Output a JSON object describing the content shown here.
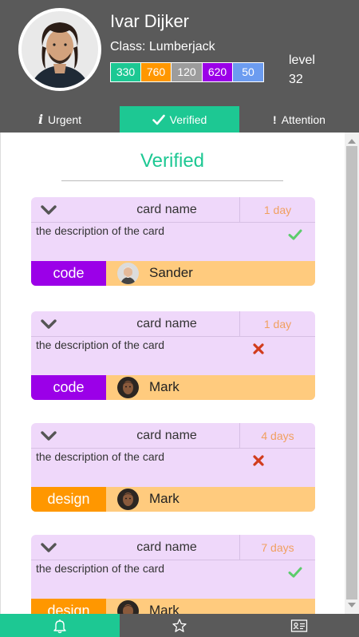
{
  "user": {
    "name": "Ivar Dijker",
    "class_label": "Class: Lumberjack",
    "stats": [
      {
        "value": "330",
        "color": "#1dc893"
      },
      {
        "value": "760",
        "color": "#ff9700"
      },
      {
        "value": "120",
        "color": "#9c9c9c"
      },
      {
        "value": "620",
        "color": "#9b00e8"
      },
      {
        "value": "50",
        "color": "#6c9cf0"
      }
    ],
    "level_label": "level",
    "level_value": "32"
  },
  "tabs": [
    {
      "label": "Urgent",
      "icon": "info-icon",
      "active": false
    },
    {
      "label": "Verified",
      "icon": "check-icon",
      "active": true
    },
    {
      "label": "Attention",
      "icon": "exclamation-icon",
      "active": false
    }
  ],
  "section": {
    "title": "Verified"
  },
  "cards": [
    {
      "name": "card name",
      "age": "1 day",
      "description": "the description of the card",
      "status": "check-icon",
      "tag": "code",
      "assignee": "Sander"
    },
    {
      "name": "card name",
      "age": "1 day",
      "description": "the description of the card",
      "status": "cross-icon",
      "tag": "code",
      "assignee": "Mark"
    },
    {
      "name": "card name",
      "age": "4 days",
      "description": "the description of the card",
      "status": "cross-icon",
      "tag": "design",
      "assignee": "Mark"
    },
    {
      "name": "card name",
      "age": "7 days",
      "description": "the description of the card",
      "status": "check-icon",
      "tag": "design",
      "assignee": "Mark"
    }
  ],
  "bottom_nav": [
    {
      "icon": "bell-icon",
      "active": true
    },
    {
      "icon": "star-icon",
      "active": false
    },
    {
      "icon": "id-card-icon",
      "active": false
    }
  ],
  "colors": {
    "accent": "#1dc893",
    "header_bg": "#5a5a5a",
    "card_bg": "#efd8fa",
    "card_footer": "#ffcb7e",
    "code_tag": "#9b00e8",
    "design_tag": "#ff9700",
    "age_text": "#f0a060"
  }
}
